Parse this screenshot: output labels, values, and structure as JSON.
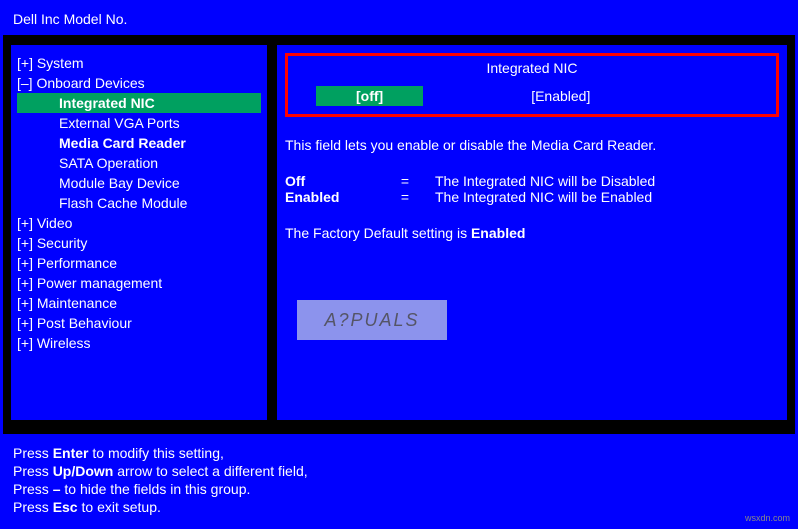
{
  "title": "Dell Inc Model No.",
  "tree": {
    "system": "[+] System",
    "onboard": "[–] Onboard Devices",
    "onboard_items": {
      "integrated_nic": "Integrated NIC",
      "external_vga": "External VGA Ports",
      "media_card": "Media Card Reader",
      "sata": "SATA Operation",
      "module_bay": "Module Bay Device",
      "flash_cache": "Flash Cache Module"
    },
    "video": "[+] Video",
    "security": "[+] Security",
    "performance": "[+] Performance",
    "power": "[+] Power management",
    "maintenance": "[+] Maintenance",
    "post": "[+] Post Behaviour",
    "wireless": "[+] Wireless"
  },
  "field": {
    "title": "Integrated NIC",
    "selected": "[off]",
    "other": "[Enabled]"
  },
  "description": "This field lets you enable or disable the Media Card Reader.",
  "values": {
    "off_label": "Off",
    "off_desc": "The Integrated NIC will be Disabled",
    "enabled_label": "Enabled",
    "enabled_desc": "The Integrated NIC will be Enabled",
    "eq": "="
  },
  "factory": {
    "prefix": "The Factory Default setting is ",
    "value": "Enabled"
  },
  "watermark": "A?PUALS",
  "footer": {
    "l1a": "Press ",
    "l1b": "Enter",
    "l1c": " to modify this setting,",
    "l2a": "Press ",
    "l2b": "Up/Down",
    "l2c": " arrow to select a different field,",
    "l3a": "Press ",
    "l3b": "–",
    "l3c": " to hide the fields in this group.",
    "l4a": "Press ",
    "l4b": "Esc",
    "l4c": " to exit setup."
  },
  "credit": "wsxdn.com"
}
